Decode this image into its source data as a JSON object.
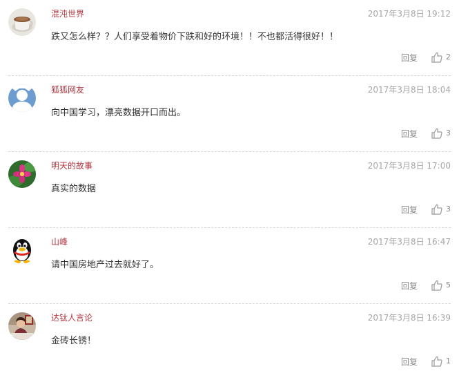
{
  "comments": [
    {
      "username": "混沌世界",
      "time": "2017年3月8日 19:12",
      "content": "跌又怎么样？？人们享受着物价下跌和好的环境！！不也都活得很好！！",
      "reply_label": "回复",
      "likes": "2",
      "avatar_icon": "coffee-cup-avatar"
    },
    {
      "username": "狐狐网友",
      "time": "2017年3月8日 18:04",
      "content": "向中国学习，漂亮数据开口而出。",
      "reply_label": "回复",
      "likes": "3",
      "avatar_icon": "default-user-avatar"
    },
    {
      "username": "明天的故事",
      "time": "2017年3月8日 17:00",
      "content": "真实的数据",
      "reply_label": "回复",
      "likes": "3",
      "avatar_icon": "flower-avatar"
    },
    {
      "username": "山峰",
      "time": "2017年3月8日 16:47",
      "content": "请中国房地产过去就好了。",
      "reply_label": "回复",
      "likes": "5",
      "avatar_icon": "penguin-avatar"
    },
    {
      "username": "达钛人言论",
      "time": "2017年3月8日 16:39",
      "content": "金砖长锈！",
      "reply_label": "回复",
      "likes": "1",
      "avatar_icon": "photo-avatar"
    }
  ],
  "colors": {
    "username": "#b0363f",
    "timestamp": "#a5a5a5",
    "content": "#333333",
    "action": "#8a8a8a",
    "divider": "#d6d6d6"
  }
}
